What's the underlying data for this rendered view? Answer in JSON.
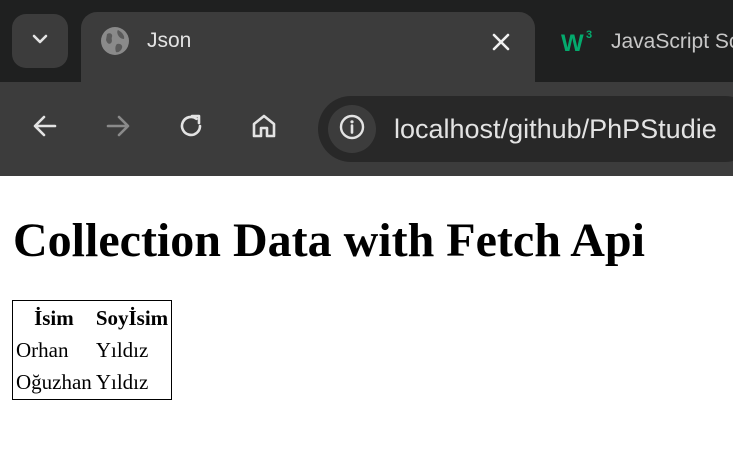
{
  "browser": {
    "tabs": [
      {
        "title": "Json",
        "favicon": "globe-icon",
        "active": true
      },
      {
        "title": "JavaScript Sc",
        "favicon": "w3schools-icon",
        "active": false
      }
    ],
    "address_bar": {
      "url": "localhost/github/PhPStudie",
      "site_info_icon": "info-icon"
    },
    "colors": {
      "tabstrip_bg": "#1f2020",
      "toolbar_bg": "#3c3c3c",
      "omnibox_bg": "#282828",
      "w3schools_green": "#04aa6d"
    }
  },
  "page": {
    "title": "Collection Data with Fetch Api",
    "table": {
      "headers": [
        "İsim",
        "Soyİsim"
      ],
      "rows": [
        [
          "Orhan",
          "Yıldız"
        ],
        [
          "Oğuzhan",
          "Yıldız"
        ]
      ]
    }
  }
}
